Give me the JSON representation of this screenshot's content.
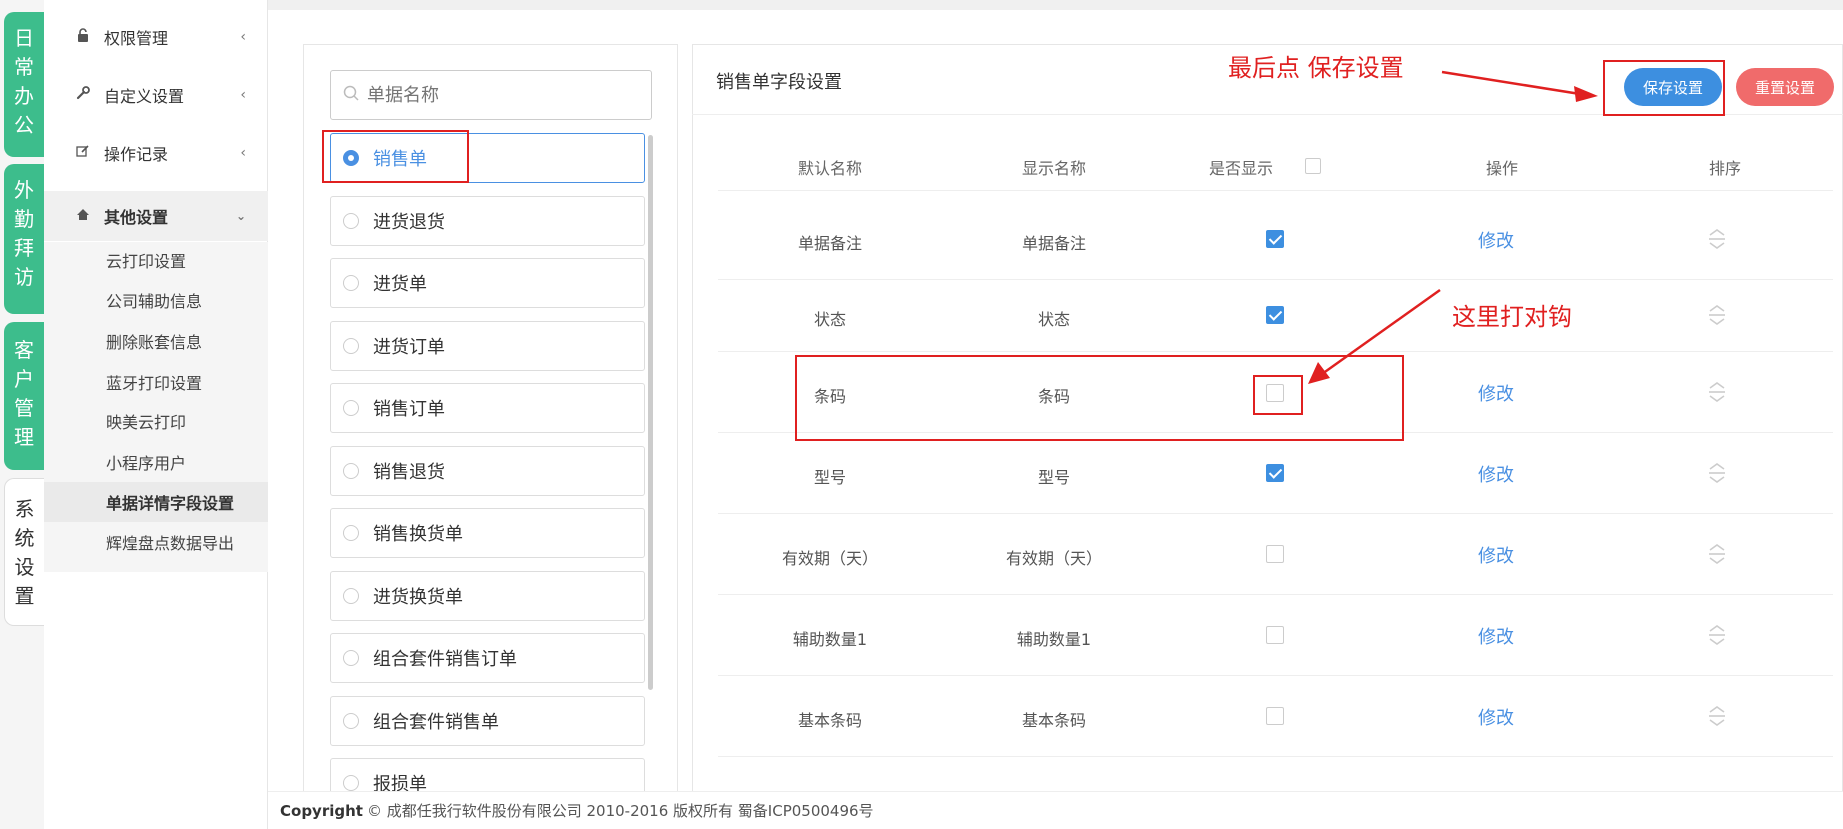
{
  "left_tabs": [
    {
      "label": "日常办公"
    },
    {
      "label": "外勤拜访"
    },
    {
      "label": "客户管理"
    },
    {
      "label": "系统设置"
    }
  ],
  "menu": {
    "items": [
      {
        "label": "权限管理",
        "icon": "lock-icon"
      },
      {
        "label": "自定义设置",
        "icon": "wrench-icon"
      },
      {
        "label": "操作记录",
        "icon": "edit-icon"
      },
      {
        "label": "其他设置",
        "icon": "home-icon"
      }
    ],
    "sub_items": [
      "云打印设置",
      "公司辅助信息",
      "删除账套信息",
      "蓝牙打印设置",
      "映美云打印",
      "小程序用户",
      "单据详情字段设置",
      "辉煌盘点数据导出"
    ]
  },
  "search": {
    "placeholder": "单据名称"
  },
  "documents": [
    "销售单",
    "进货退货",
    "进货单",
    "进货订单",
    "销售订单",
    "销售退货",
    "销售换货单",
    "进货换货单",
    "组合套件销售订单",
    "组合套件销售单",
    "报损单"
  ],
  "panel": {
    "title": "销售单字段设置",
    "save_label": "保存设置",
    "reset_label": "重置设置"
  },
  "table": {
    "headers": [
      "默认名称",
      "显示名称",
      "是否显示",
      "操作",
      "排序"
    ],
    "edit_label": "修改",
    "rows": [
      {
        "default": "单据备注",
        "display": "单据备注",
        "shown": true,
        "editable": true
      },
      {
        "default": "状态",
        "display": "状态",
        "shown": true,
        "editable": false
      },
      {
        "default": "条码",
        "display": "条码",
        "shown": false,
        "editable": true
      },
      {
        "default": "型号",
        "display": "型号",
        "shown": true,
        "editable": true
      },
      {
        "default": "有效期（天）",
        "display": "有效期（天）",
        "shown": false,
        "editable": true
      },
      {
        "default": "辅助数量1",
        "display": "辅助数量1",
        "shown": false,
        "editable": true
      },
      {
        "default": "基本条码",
        "display": "基本条码",
        "shown": false,
        "editable": true
      }
    ]
  },
  "annotations": {
    "save_hint": "最后点 保存设置",
    "check_hint": "这里打对钩"
  },
  "footer": {
    "brand": "Copyright",
    "text": "© 成都任我行软件股份有限公司 2010-2016 版权所有 蜀备ICP0500496号"
  },
  "colors": {
    "accent": "#3d8fe0",
    "tab_green": "#3dbd8c",
    "reset_red": "#f06b6b",
    "annotation_red": "#e02020"
  }
}
